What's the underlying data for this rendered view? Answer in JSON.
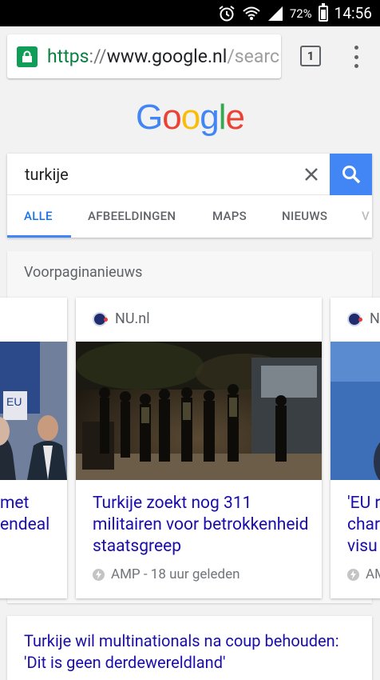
{
  "status_bar": {
    "battery_percent": "72%",
    "time": "14:56",
    "icons": [
      "alarm-icon",
      "wifi-icon",
      "signal-icon",
      "battery-icon"
    ]
  },
  "browser": {
    "url_scheme": "https",
    "url_separator": "://",
    "url_host": "www.google.nl",
    "url_path": "/searc",
    "tab_count": "1"
  },
  "logo": {
    "letters": [
      "G",
      "o",
      "o",
      "g",
      "l",
      "e"
    ],
    "colors": [
      "#4285F4",
      "#EA4335",
      "#FBBC05",
      "#4285F4",
      "#34A853",
      "#EA4335"
    ]
  },
  "search": {
    "query": "turkije",
    "tabs": [
      {
        "label": "ALLE",
        "active": true
      },
      {
        "label": "AFBEELDINGEN",
        "active": false
      },
      {
        "label": "MAPS",
        "active": false
      },
      {
        "label": "NIEUWS",
        "active": false
      },
      {
        "label": "V",
        "active": false
      }
    ]
  },
  "news": {
    "header": "Voorpaginanieuws",
    "cards": [
      {
        "source": "",
        "title": "met\nendeal",
        "meta": ""
      },
      {
        "source": "NU.nl",
        "title": "Turkije zoekt nog 311 militairen voor betrokkenheid staatsgreep",
        "meta": "AMP - 18 uur geleden"
      },
      {
        "source": "N",
        "title": "'EU r\nchar\nvisu",
        "meta": "AM"
      }
    ]
  },
  "result": {
    "title": "Turkije wil multinationals na coup behouden: 'Dit is geen derdewereldland'"
  },
  "colors": {
    "link": "#1a0dab",
    "accent_blue": "#4285f4",
    "secure_green": "#0f9d58"
  }
}
